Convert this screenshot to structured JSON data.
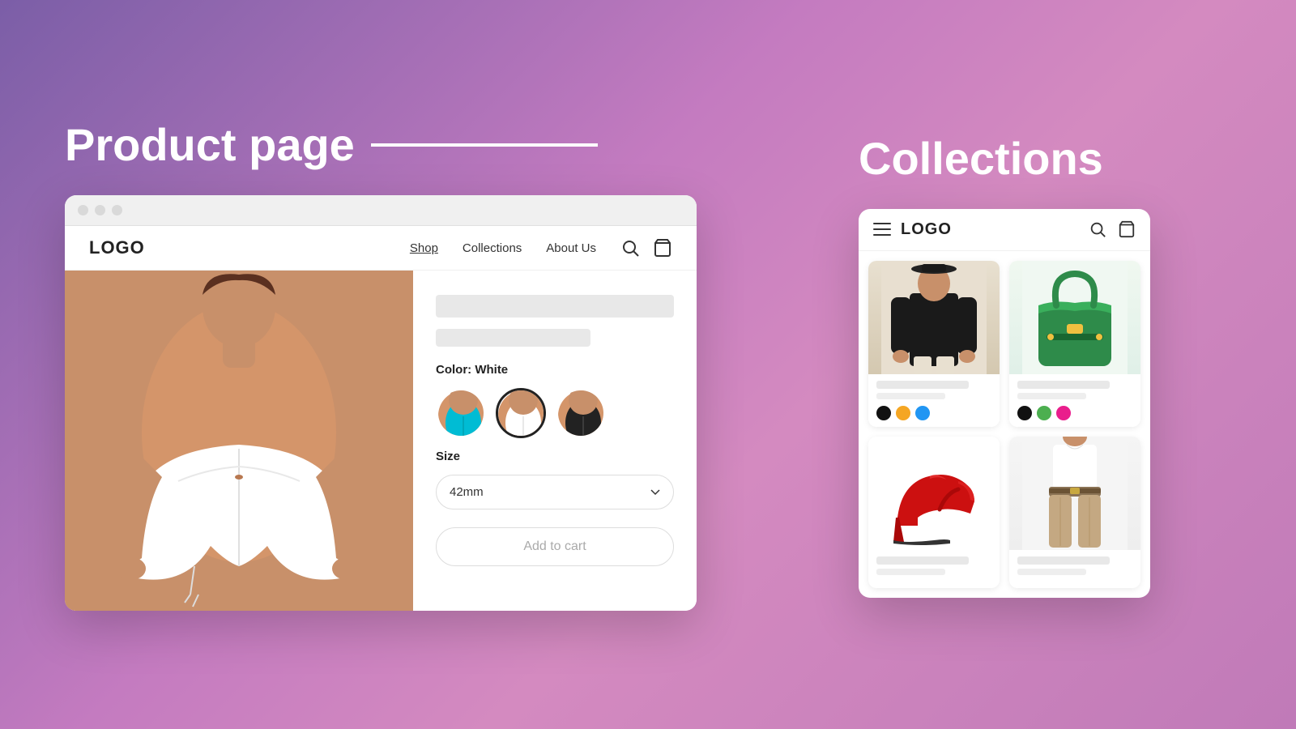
{
  "left": {
    "title": "Product page",
    "nav": {
      "logo": "LOGO",
      "links": [
        {
          "label": "Shop",
          "active": true
        },
        {
          "label": "Collections",
          "active": false
        },
        {
          "label": "About Us",
          "active": false
        }
      ]
    },
    "product": {
      "color_label": "Color: White",
      "size_label": "Size",
      "size_value": "42mm",
      "add_to_cart": "Add to cart",
      "swatches": [
        "Cyan",
        "White",
        "Black"
      ]
    }
  },
  "right": {
    "title": "Collections",
    "nav": {
      "logo": "LOGO"
    },
    "cards": [
      {
        "type": "black-shirt",
        "colors": [
          "#111111",
          "#f5a623",
          "#2196F3"
        ]
      },
      {
        "type": "green-bag",
        "colors": [
          "#111111",
          "#4CAF50",
          "#E91E8C"
        ]
      },
      {
        "type": "red-heels",
        "colors": []
      },
      {
        "type": "pants",
        "colors": []
      }
    ]
  }
}
